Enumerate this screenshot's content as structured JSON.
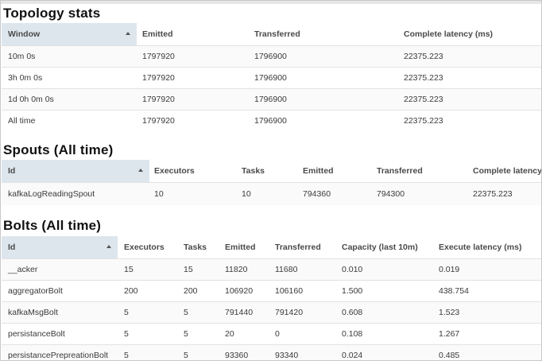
{
  "topology": {
    "title": "Topology stats",
    "headers": [
      "Window",
      "Emitted",
      "Transferred",
      "Complete latency (ms)"
    ],
    "rows": [
      [
        "10m 0s",
        "1797920",
        "1796900",
        "22375.223"
      ],
      [
        "3h 0m 0s",
        "1797920",
        "1796900",
        "22375.223"
      ],
      [
        "1d 0h 0m 0s",
        "1797920",
        "1796900",
        "22375.223"
      ],
      [
        "All time",
        "1797920",
        "1796900",
        "22375.223"
      ]
    ]
  },
  "spouts": {
    "title": "Spouts (All time)",
    "headers": [
      "Id",
      "Executors",
      "Tasks",
      "Emitted",
      "Transferred",
      "Complete latency"
    ],
    "rows": [
      [
        "kafkaLogReadingSpout",
        "10",
        "10",
        "794360",
        "794300",
        "22375.223"
      ]
    ]
  },
  "bolts": {
    "title": "Bolts (All time)",
    "headers": [
      "Id",
      "Executors",
      "Tasks",
      "Emitted",
      "Transferred",
      "Capacity (last 10m)",
      "Execute latency (ms)"
    ],
    "rows": [
      [
        "__acker",
        "15",
        "15",
        "11820",
        "11680",
        "0.010",
        "0.019"
      ],
      [
        "aggregatorBolt",
        "200",
        "200",
        "106920",
        "106160",
        "1.500",
        "438.754"
      ],
      [
        "kafkaMsgBolt",
        "5",
        "5",
        "791440",
        "791420",
        "0.608",
        "1.523"
      ],
      [
        "persistanceBolt",
        "5",
        "5",
        "20",
        "0",
        "0.108",
        "1.267"
      ],
      [
        "persistancePrepreationBolt",
        "5",
        "5",
        "93360",
        "93340",
        "0.024",
        "0.485"
      ]
    ]
  }
}
